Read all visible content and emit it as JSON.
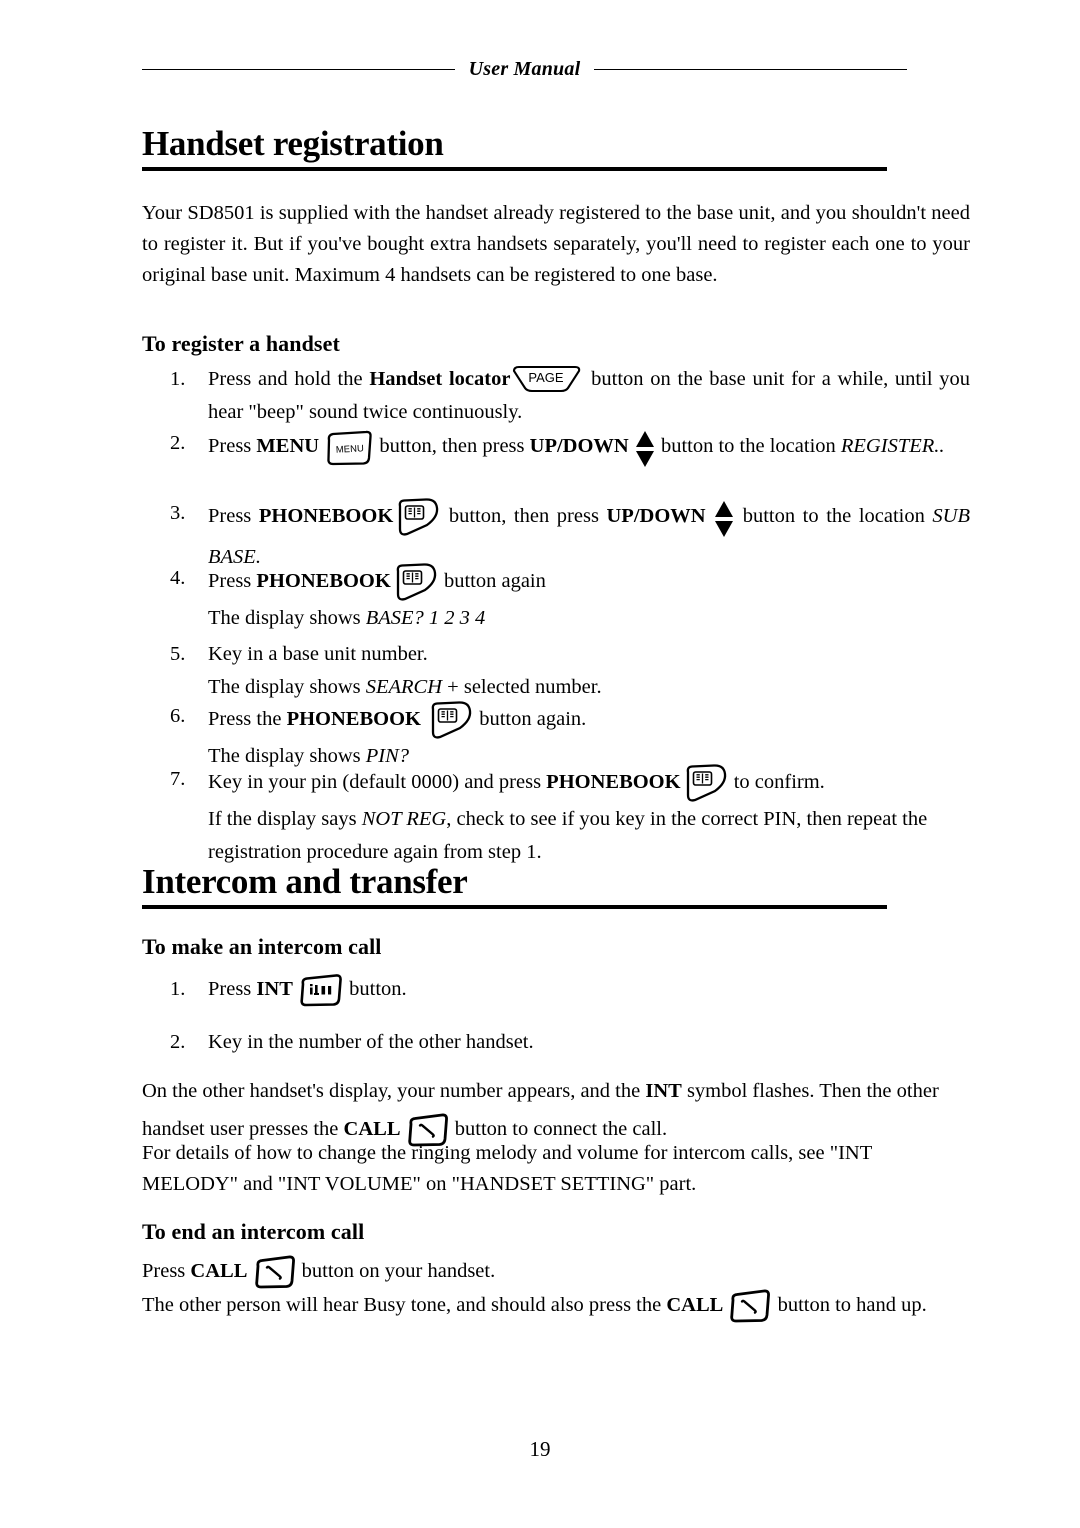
{
  "document": {
    "header_title": "User Manual",
    "page_number": "19"
  },
  "sections": [
    {
      "heading": "Handset registration",
      "intro": "Your SD8501 is supplied with the handset already registered to the base unit, and you shouldn't need to register it. But if you've bought extra handsets separately, you'll need to register each one to your original base unit. Maximum 4 handsets can be registered to one base.",
      "subhead": "To register a handset",
      "steps": [
        {
          "number": "1.",
          "part1": "Press and hold the ",
          "bold1": "Handset locator",
          "icon": "page-button-icon",
          "part2": " button on the base unit for a while, until you hear \"beep\" sound twice continuously."
        },
        {
          "number": "2.",
          "part1": "Press ",
          "bold1": "MENU",
          "icon": "menu-button-icon",
          "part2": " button, then press ",
          "bold2": "UP/DOWN",
          "icon2": "up-down-button-icon",
          "part3": " button to the location ",
          "italic1": "REGISTER.."
        },
        {
          "number": "3.",
          "part1": "Press ",
          "bold1": "PHONEBOOK",
          "icon": "phonebook-button-icon",
          "part2": " button, then press ",
          "bold2": "UP/DOWN",
          "icon2": "up-down-button-icon",
          "part3": " button to the location ",
          "italic1": "SUB BASE."
        },
        {
          "number": "4.",
          "part1": "Press ",
          "bold1": "PHONEBOOK",
          "icon": "phonebook-button-icon",
          "part2": " button again",
          "line2a": "The display shows ",
          "line2i": "BASE? 1 2 3 4"
        },
        {
          "number": "5.",
          "part1": " Key in a base unit number.",
          "line2a": "The display shows ",
          "line2i": "SEARCH",
          "line2b": " + selected number."
        },
        {
          "number": "6.",
          "part1": "Press the ",
          "bold1": "PHONEBOOK",
          "icon": "phonebook-button-icon",
          "part2": " button again.",
          "line2a": "The display shows ",
          "line2i": "PIN?"
        },
        {
          "number": "7.",
          "part1": "Key in your pin (default 0000) and press ",
          "bold1": "PHONEBOOK",
          "icon": "phonebook-button-icon",
          "part2": " to confirm.",
          "line2a": "If the display says ",
          "line2i": "NOT REG",
          "line2b": ", check to see if you key in the correct PIN, then repeat the registration procedure again from step 1."
        }
      ]
    },
    {
      "heading": "Intercom and transfer",
      "subhead": "To make an intercom call",
      "steps": [
        {
          "number": "1.",
          "part1": "Press ",
          "bold1": "INT",
          "icon": "int-button-icon",
          "part2": " button."
        },
        {
          "number": "2.",
          "part1": "Key in the number of the other handset."
        }
      ],
      "body_p1a": "On the other handset's display, your number appears, and the ",
      "body_p1b": "INT",
      "body_p1c": " symbol flashes. Then the other handset user presses the ",
      "body_p1d": "CALL",
      "body_p1e": " button to connect the call.",
      "body_p2": "For details of how to change the ringing melody and volume for intercom calls, see \"INT MELODY\" and \"INT VOLUME\" on \"HANDSET SETTING\" part.",
      "subhead2": "To end an intercom call",
      "end_p1a": "Press ",
      "end_p1b": "CALL",
      "end_p1c": " button on your handset.",
      "end_p2a": "The other person will hear Busy tone, and should also press the ",
      "end_p2b": "CALL",
      "end_p2c": " button to hand up."
    }
  ],
  "icons": {
    "page_label": "PAGE",
    "menu_label": "MENU"
  }
}
